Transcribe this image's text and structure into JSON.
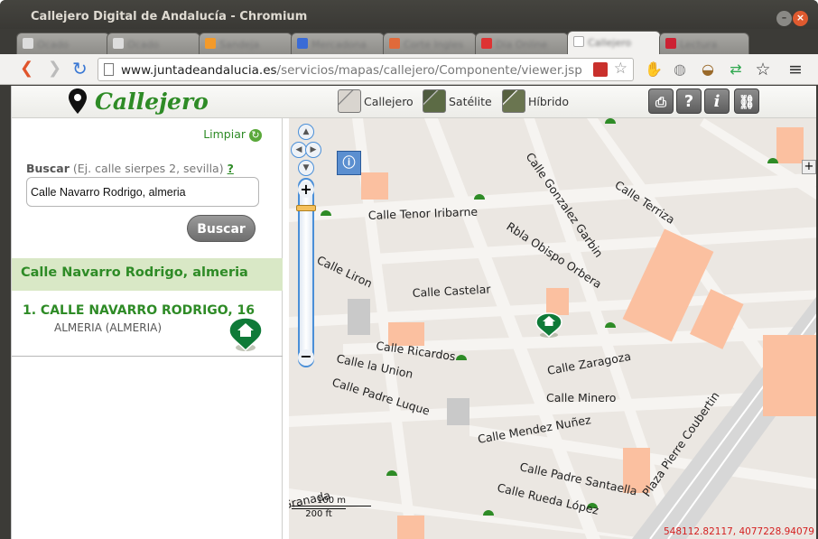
{
  "window": {
    "title": "Callejero Digital de Andalucía - Chromium"
  },
  "browser": {
    "tabs": [
      {
        "label": "Ocado"
      },
      {
        "label": "Ocado"
      },
      {
        "label": "Sandeja"
      },
      {
        "label": "Mercadona"
      },
      {
        "label": "Corte Ingles"
      },
      {
        "label": "Dia Online"
      },
      {
        "label": "Callejero"
      },
      {
        "label": "Lectura"
      }
    ],
    "url_host": "www.juntadeandalucia.es",
    "url_path": "/servicios/mapas/callejero/Componente/viewer.jsp"
  },
  "app": {
    "logo_text": "Callejero",
    "map_types": [
      {
        "label": "Callejero"
      },
      {
        "label": "Satélite"
      },
      {
        "label": "Híbrido"
      }
    ],
    "tools": {
      "print_icon": "print-icon",
      "help_label": "?",
      "info_label": "i",
      "link_icon": "link-icon"
    }
  },
  "sidebar": {
    "clear_label": "Limpiar",
    "search_label": "Buscar",
    "search_hint": "(Ej. calle sierpes 2, sevilla)",
    "help_label": "?",
    "search_value": "Calle Navarro Rodrigo, almeria",
    "search_button": "Buscar",
    "results_header": "Calle Navarro Rodrigo, almeria",
    "results": [
      {
        "title": "1. CALLE NAVARRO RODRIGO, 16",
        "subtitle": "ALMERIA (ALMERIA)"
      }
    ]
  },
  "map": {
    "streets": [
      "Calle Tenor Iribarne",
      "Rbla Obispo Orbera",
      "Calle Gonzalez Garbin",
      "Calle Terriza",
      "Calle Castelar",
      "Calle Liron",
      "Calle Ricardos",
      "Calle la Union",
      "Calle Padre Luque",
      "Calle Zaragoza",
      "Calle Minero",
      "Calle Mendez Nuñez",
      "Calle Padre Santaella",
      "Calle Rueda López",
      "Plaza Pierre Coubertin",
      "Calle Granada"
    ],
    "scale_top": "100 m",
    "scale_bottom": "200 ft",
    "coordinates": "548112.82117, 4077228.94079"
  }
}
